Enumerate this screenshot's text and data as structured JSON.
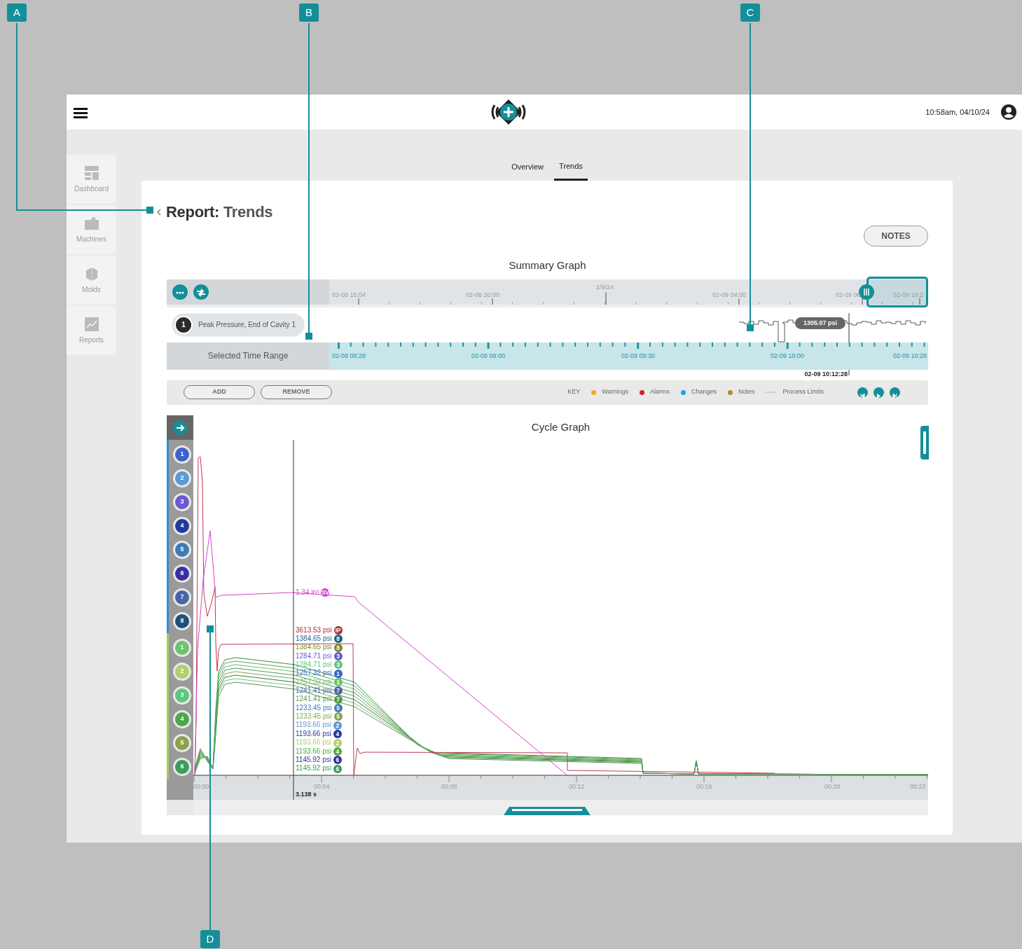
{
  "callouts": [
    {
      "letter": "A"
    },
    {
      "letter": "B"
    },
    {
      "letter": "C"
    },
    {
      "letter": "D"
    }
  ],
  "header": {
    "time": "10:58am, 04/10/24"
  },
  "sidebar": {
    "items": [
      {
        "label": "Dashboard",
        "kind": "dashboard"
      },
      {
        "label": "Machines",
        "kind": "machines"
      },
      {
        "label": "Molds",
        "kind": "molds"
      },
      {
        "label": "Reports",
        "kind": "reports"
      }
    ]
  },
  "tabs": [
    {
      "label": "Overview",
      "selected": false
    },
    {
      "label": "Trends",
      "selected": true
    }
  ],
  "page": {
    "title_lead": "Report:",
    "title_main": "Trends",
    "notes_button": "NOTES"
  },
  "summary_graph": {
    "title": "Summary Graph",
    "top_axis_labels": [
      {
        "text": "02-08 15:04",
        "kind": "time"
      },
      {
        "text": "02-08 20:00",
        "kind": "time"
      },
      {
        "text": "2/9/24",
        "kind": "day"
      },
      {
        "text": "02-09 04:00",
        "kind": "time"
      },
      {
        "text": "02-09 08",
        "kind": "time"
      },
      {
        "text": "02-09 10:2",
        "kind": "time"
      }
    ],
    "series_pill": {
      "number": "1",
      "label": "Peak Pressure, End of Cavity 1"
    },
    "value_tag": "1305.07 psi",
    "range_label": "Selected Time Range",
    "range_axis_labels": [
      "02-09 08:28",
      "02-09 09:00",
      "02-09 09:30",
      "02-09 10:00",
      "02-09 10:28"
    ],
    "cursor_time": "02-09 10:12:28"
  },
  "toolbar": {
    "buttons": [
      "ADD",
      "REMOVE"
    ],
    "key_label": "KEY",
    "legend": [
      {
        "label": "Warnings",
        "kind": "dot",
        "color": "#f5a623"
      },
      {
        "label": "Alarms",
        "kind": "dot",
        "color": "#d0202e"
      },
      {
        "label": "Changes",
        "kind": "dot",
        "color": "#1aa3e8"
      },
      {
        "label": "Notes",
        "kind": "dot",
        "color": "#b08d2a"
      },
      {
        "label": "Process Limits",
        "kind": "dashes"
      }
    ]
  },
  "cycle_graph": {
    "title": "Cycle Graph",
    "channel_groups": [
      {
        "color": "#2b8fd6",
        "channels": [
          {
            "number": "1",
            "color": "#3b63c9"
          },
          {
            "number": "2",
            "color": "#5b9bd5"
          },
          {
            "number": "3",
            "color": "#6a5acd"
          },
          {
            "number": "4",
            "color": "#23399e"
          },
          {
            "number": "5",
            "color": "#3b7cb5"
          },
          {
            "number": "6",
            "color": "#3a2fa0"
          },
          {
            "number": "7",
            "color": "#4a64a8"
          },
          {
            "number": "8",
            "color": "#1f4f7a"
          }
        ]
      },
      {
        "color": "#a5cf5b",
        "channels": [
          {
            "number": "1",
            "color": "#6cc46c"
          },
          {
            "number": "2",
            "color": "#b0cf6e"
          },
          {
            "number": "3",
            "color": "#5ec77e"
          },
          {
            "number": "4",
            "color": "#4aa84a"
          },
          {
            "number": "5",
            "color": "#8aa34a"
          },
          {
            "number": "6",
            "color": "#3a9e5a"
          }
        ]
      }
    ],
    "volume_readout": {
      "value": "1.34 in³",
      "badge": "SV",
      "color": "#d63fd6"
    },
    "readouts": [
      {
        "value": "3613.53 psi",
        "badge": "IP",
        "color": "#b5293b"
      },
      {
        "value": "1384.65 psi",
        "badge": "8",
        "color": "#1f5f8a"
      },
      {
        "value": "1384.65 psi",
        "badge": "8",
        "color": "#7a8a30"
      },
      {
        "value": "1284.71 psi",
        "badge": "3",
        "color": "#6a5acd"
      },
      {
        "value": "1284.71 psi",
        "badge": "3",
        "color": "#5ec77e"
      },
      {
        "value": "1257.32 psi",
        "badge": "1",
        "color": "#3b63c9"
      },
      {
        "value": "1257.32 psi",
        "badge": "1",
        "color": "#6cc46c"
      },
      {
        "value": "1241.41 psi",
        "badge": "7",
        "color": "#4a64a8"
      },
      {
        "value": "1241.41 psi",
        "badge": "7",
        "color": "#5a9a4a"
      },
      {
        "value": "1233.45 psi",
        "badge": "5",
        "color": "#3b7cb5"
      },
      {
        "value": "1233.45 psi",
        "badge": "5",
        "color": "#8aa34a"
      },
      {
        "value": "1193.66 psi",
        "badge": "2",
        "color": "#5b9bd5"
      },
      {
        "value": "1193.66 psi",
        "badge": "4",
        "color": "#23399e"
      },
      {
        "value": "1193.66 psi",
        "badge": "2",
        "color": "#b0cf6e"
      },
      {
        "value": "1193.66 psi",
        "badge": "4",
        "color": "#4aa84a"
      },
      {
        "value": "1145.92 psi",
        "badge": "6",
        "color": "#3a2fa0"
      },
      {
        "value": "1145.92 psi",
        "badge": "6",
        "color": "#3a9e5a"
      }
    ],
    "x_axis_labels": [
      "00:00",
      "00:04",
      "00:08",
      "00:12",
      "00:16",
      "00:20",
      "00:23"
    ],
    "cursor": "3.138 s"
  }
}
